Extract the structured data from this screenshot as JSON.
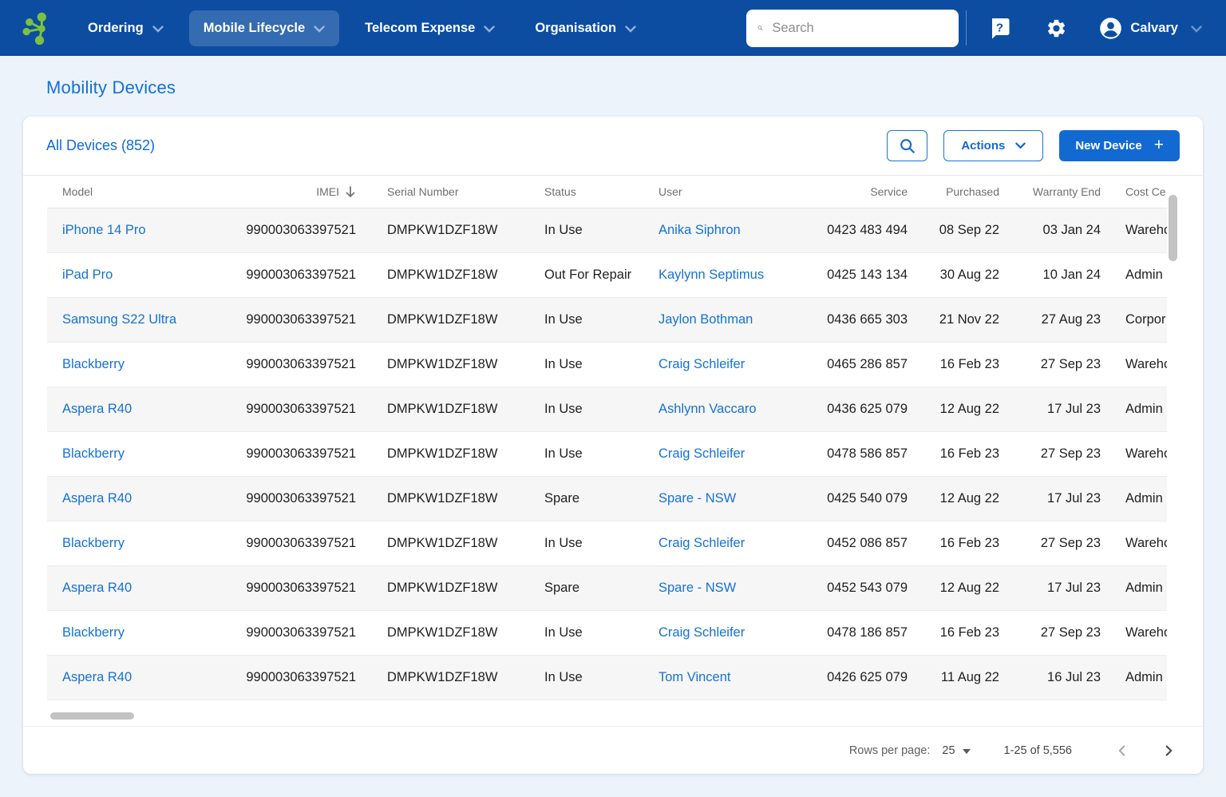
{
  "navbar": {
    "items": [
      {
        "label": "Ordering",
        "active": false
      },
      {
        "label": "Mobile Lifecycle",
        "active": true
      },
      {
        "label": "Telecom Expense",
        "active": false
      },
      {
        "label": "Organisation",
        "active": false
      }
    ],
    "search_placeholder": "Search",
    "user_name": "Calvary"
  },
  "page": {
    "title": "Mobility Devices"
  },
  "card": {
    "list_title": "All Devices (852)",
    "actions_label": "Actions",
    "new_device_label": "New Device",
    "new_device_plus": "+"
  },
  "table": {
    "columns": [
      "Model",
      "IMEI",
      "Serial Number",
      "Status",
      "User",
      "Service",
      "Purchased",
      "Warranty End",
      "Cost Ce"
    ],
    "rows": [
      {
        "model": "iPhone 14 Pro",
        "imei": "990003063397521",
        "serial": "DMPKW1DZF18W",
        "status": "In Use",
        "user": "Anika Siphron",
        "service": "0423 483 494",
        "purchased": "08 Sep 22",
        "warranty_end": "03 Jan 24",
        "cost_centre": "Wareho"
      },
      {
        "model": "iPad Pro",
        "imei": "990003063397521",
        "serial": "DMPKW1DZF18W",
        "status": "Out For Repair",
        "user": "Kaylynn Septimus",
        "service": "0425 143 134",
        "purchased": "30 Aug 22",
        "warranty_end": "10 Jan 24",
        "cost_centre": "Admin"
      },
      {
        "model": "Samsung S22 Ultra",
        "imei": "990003063397521",
        "serial": "DMPKW1DZF18W",
        "status": "In Use",
        "user": "Jaylon Bothman",
        "service": "0436 665 303",
        "purchased": "21 Nov 22",
        "warranty_end": "27 Aug 23",
        "cost_centre": "Corpor"
      },
      {
        "model": "Blackberry",
        "imei": "990003063397521",
        "serial": "DMPKW1DZF18W",
        "status": "In Use",
        "user": "Craig Schleifer",
        "service": "0465 286 857",
        "purchased": "16 Feb 23",
        "warranty_end": "27 Sep 23",
        "cost_centre": "Wareho"
      },
      {
        "model": "Aspera R40",
        "imei": "990003063397521",
        "serial": "DMPKW1DZF18W",
        "status": "In Use",
        "user": "Ashlynn Vaccaro",
        "service": "0436 625 079",
        "purchased": "12 Aug 22",
        "warranty_end": "17 Jul 23",
        "cost_centre": "Admin"
      },
      {
        "model": "Blackberry",
        "imei": "990003063397521",
        "serial": "DMPKW1DZF18W",
        "status": "In Use",
        "user": "Craig Schleifer",
        "service": "0478 586 857",
        "purchased": "16 Feb 23",
        "warranty_end": "27 Sep 23",
        "cost_centre": "Wareho"
      },
      {
        "model": "Aspera R40",
        "imei": "990003063397521",
        "serial": "DMPKW1DZF18W",
        "status": "Spare",
        "user": "Spare - NSW",
        "service": "0425 540 079",
        "purchased": "12 Aug 22",
        "warranty_end": "17 Jul 23",
        "cost_centre": "Admin"
      },
      {
        "model": "Blackberry",
        "imei": "990003063397521",
        "serial": "DMPKW1DZF18W",
        "status": "In Use",
        "user": "Craig Schleifer",
        "service": "0452 086 857",
        "purchased": "16 Feb 23",
        "warranty_end": "27 Sep 23",
        "cost_centre": "Wareho"
      },
      {
        "model": "Aspera R40",
        "imei": "990003063397521",
        "serial": "DMPKW1DZF18W",
        "status": "Spare",
        "user": "Spare - NSW",
        "service": "0452 543 079",
        "purchased": "12 Aug 22",
        "warranty_end": "17 Jul 23",
        "cost_centre": "Admin"
      },
      {
        "model": "Blackberry",
        "imei": "990003063397521",
        "serial": "DMPKW1DZF18W",
        "status": "In Use",
        "user": "Craig Schleifer",
        "service": "0478 186 857",
        "purchased": "16 Feb 23",
        "warranty_end": "27 Sep 23",
        "cost_centre": "Wareho"
      },
      {
        "model": "Aspera R40",
        "imei": "990003063397521",
        "serial": "DMPKW1DZF18W",
        "status": "In Use",
        "user": "Tom Vincent",
        "service": "0426 625 079",
        "purchased": "11 Aug 22",
        "warranty_end": "16 Jul 23",
        "cost_centre": "Admin"
      }
    ]
  },
  "footer": {
    "rows_per_page_label": "Rows per page:",
    "rows_per_page_value": "25",
    "range_label": "1-25 of 5,556"
  },
  "colors": {
    "navbar_blue": "#0C4DA2",
    "accent_blue": "#1269D2",
    "logo_green": "#7CC142"
  }
}
